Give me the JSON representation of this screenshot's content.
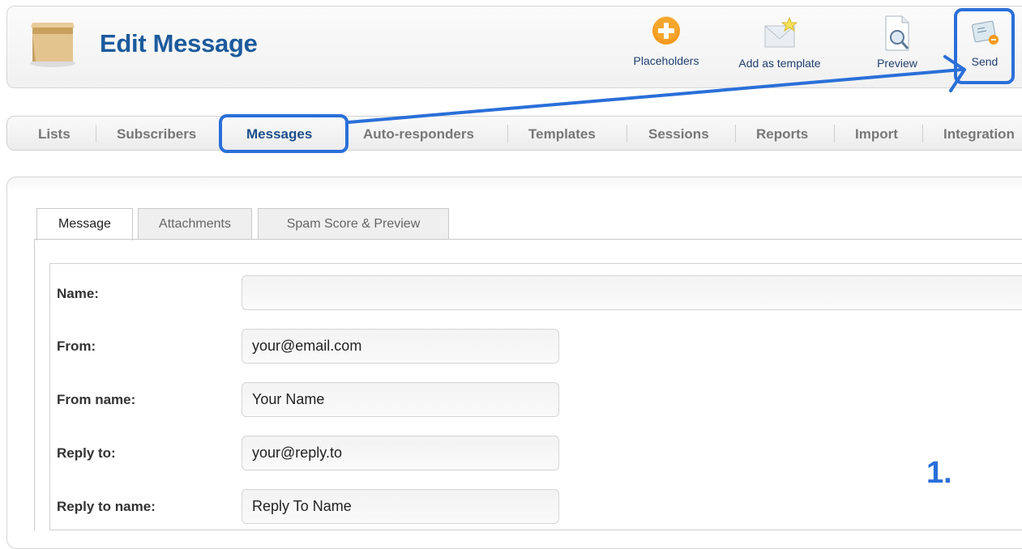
{
  "header": {
    "title": "Edit Message",
    "toolbar": {
      "placeholders": "Placeholders",
      "add_template": "Add as template",
      "preview": "Preview",
      "send": "Send"
    }
  },
  "nav": {
    "items": [
      "Lists",
      "Subscribers",
      "Messages",
      "Auto-responders",
      "Templates",
      "Sessions",
      "Reports",
      "Import",
      "Integration"
    ],
    "active": "Messages"
  },
  "tabs": [
    "Message",
    "Attachments",
    "Spam Score & Preview"
  ],
  "form": {
    "name_label": "Name:",
    "name_value": "",
    "from_label": "From:",
    "from_value": "your@email.com",
    "from_name_label": "From name:",
    "from_name_value": "Your Name",
    "reply_to_label": "Reply to:",
    "reply_to_value": "your@reply.to",
    "reply_to_name_label": "Reply to name:",
    "reply_to_name_value": "Reply To Name"
  },
  "annotation": {
    "step": "1."
  },
  "colors": {
    "title": "#1c5a9c",
    "highlight": "#2a6fd8",
    "toolbar_text": "#1f3f70"
  }
}
